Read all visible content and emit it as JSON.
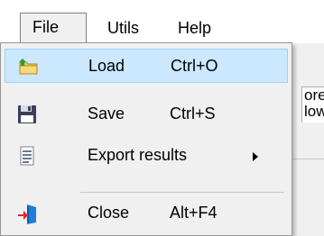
{
  "menubar": {
    "items": [
      {
        "label": "File"
      },
      {
        "label": "Utils"
      },
      {
        "label": "Help"
      }
    ]
  },
  "background": {
    "text_line1": "ore:",
    "text_line2": "low"
  },
  "file_menu": {
    "items": [
      {
        "label": "Load",
        "shortcut": "Ctrl+O",
        "icon": "folder-open-icon",
        "highlighted": true
      },
      {
        "label": "Save",
        "shortcut": "Ctrl+S",
        "icon": "floppy-disk-icon"
      },
      {
        "label": "Export results",
        "shortcut": "",
        "icon": "document-icon",
        "has_submenu": true
      },
      {
        "label": "Close",
        "shortcut": "Alt+F4",
        "icon": "exit-door-icon"
      }
    ]
  },
  "colors": {
    "highlight_bg": "#cce8ff",
    "highlight_border": "#99d1ff"
  }
}
